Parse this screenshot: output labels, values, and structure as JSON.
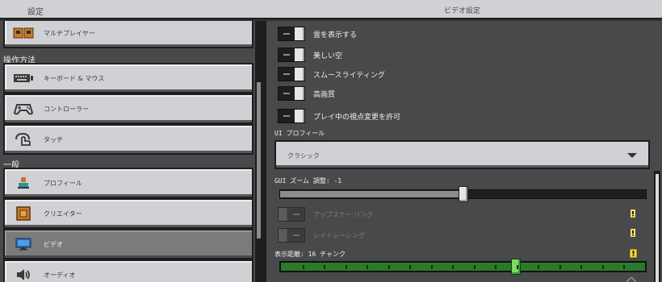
{
  "header": {
    "left_title": "設定",
    "right_title": "ビデオ設定"
  },
  "sidebar": {
    "items_top": [
      {
        "label": "マルチプレイヤー",
        "icon": "multiplayer-icon"
      }
    ],
    "section_controls": "操作方法",
    "controls_items": [
      {
        "label": "キーボード & マウス",
        "icon": "keyboard-icon"
      },
      {
        "label": "コントローラー",
        "icon": "controller-icon"
      },
      {
        "label": "タッチ",
        "icon": "touch-icon"
      }
    ],
    "section_general": "一般",
    "general_items": [
      {
        "label": "プロフィール",
        "icon": "profile-icon"
      },
      {
        "label": "クリエイター",
        "icon": "creator-icon"
      },
      {
        "label": "ビデオ",
        "icon": "video-icon",
        "selected": true
      },
      {
        "label": "オーディオ",
        "icon": "audio-icon"
      }
    ]
  },
  "video": {
    "toggles": [
      {
        "label": "雲を表示する",
        "on": true
      },
      {
        "label": "美しい空",
        "on": true
      },
      {
        "label": "スムースライティング",
        "on": true
      },
      {
        "label": "高画質",
        "on": true
      },
      {
        "label": "プレイ中の視点変更を許可",
        "on": true
      }
    ],
    "ui_profile_label": "UI プロフィール",
    "ui_profile_value": "クラシック",
    "gui_zoom_label": "GUI ズーム 調整: -1",
    "gui_zoom_fraction": 0.5,
    "disabled_toggles": [
      {
        "label": "アップスケー リング",
        "warning": "info"
      },
      {
        "label": "レイトレーシング",
        "warning": "info"
      }
    ],
    "render_distance_label": "表示距離: 16 チャンク",
    "render_distance_warning": "alert",
    "render_distance_fraction": 0.645
  },
  "colors": {
    "panel": "#48494a",
    "button": "#d0d1d4",
    "selected_button": "#7a7b7d",
    "green_slider": "#2b7a2b",
    "warning_yellow": "#ffd83a"
  }
}
